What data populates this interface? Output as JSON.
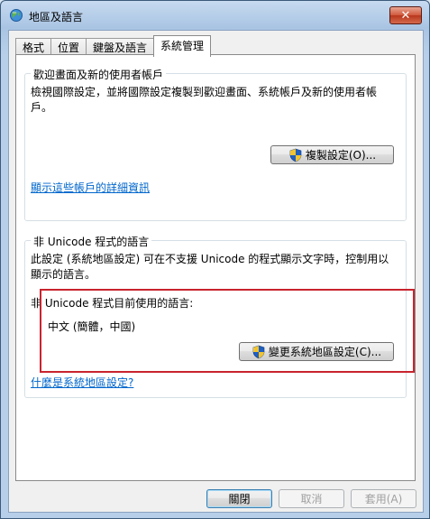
{
  "window": {
    "title": "地區及語言",
    "close_symbol": "✕"
  },
  "tabs": [
    {
      "label": "格式"
    },
    {
      "label": "位置"
    },
    {
      "label": "鍵盤及語言"
    },
    {
      "label": "系統管理"
    }
  ],
  "welcome_group": {
    "label": "歡迎畫面及新的使用者帳戶",
    "description": "檢視國際設定，並將國際設定複製到歡迎畫面、系統帳戶及新的使用者帳戶。",
    "copy_button": "複製設定(O)...",
    "link": "顯示這些帳戶的詳細資訊"
  },
  "nonunicode_group": {
    "label": "非 Unicode 程式的語言",
    "description": "此設定 (系統地區設定) 可在不支援 Unicode 的程式顯示文字時，控制用以顯示的語言。",
    "current_label": "非 Unicode 程式目前使用的語言:",
    "current_value": "中文 (簡體，中國)",
    "change_button": "變更系統地區設定(C)...",
    "link": "什麼是系統地區設定?"
  },
  "footer": {
    "close": "關閉",
    "cancel": "取消",
    "apply": "套用(A)"
  },
  "colors": {
    "highlight_border": "#c8242e",
    "link": "#0066cc"
  }
}
